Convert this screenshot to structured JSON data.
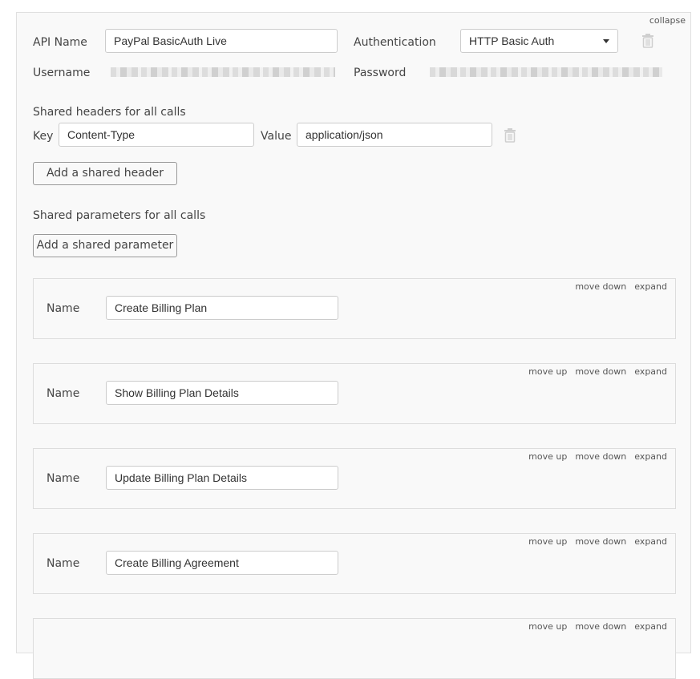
{
  "collapse_label": "collapse",
  "api": {
    "name_label": "API Name",
    "name_value": "PayPal BasicAuth Live",
    "auth_label": "Authentication",
    "auth_value": "HTTP Basic Auth",
    "username_label": "Username",
    "password_label": "Password"
  },
  "shared_headers": {
    "title": "Shared headers for all calls",
    "key_label": "Key",
    "key_value": "Content-Type",
    "value_label": "Value",
    "value_value": "application/json",
    "add_button": "Add a shared header"
  },
  "shared_params": {
    "title": "Shared parameters for all calls",
    "add_button": "Add a shared parameter"
  },
  "call_links": {
    "move_up": "move up",
    "move_down": "move down",
    "expand": "expand"
  },
  "calls": [
    {
      "name_label": "Name",
      "name_value": "Create Billing Plan"
    },
    {
      "name_label": "Name",
      "name_value": "Show Billing Plan Details"
    },
    {
      "name_label": "Name",
      "name_value": "Update Billing Plan Details"
    },
    {
      "name_label": "Name",
      "name_value": "Create Billing Agreement"
    },
    {
      "name_label": "Name",
      "name_value": ""
    }
  ],
  "icons": {
    "delete": "trash-icon",
    "dropdown": "caret-down-icon"
  }
}
